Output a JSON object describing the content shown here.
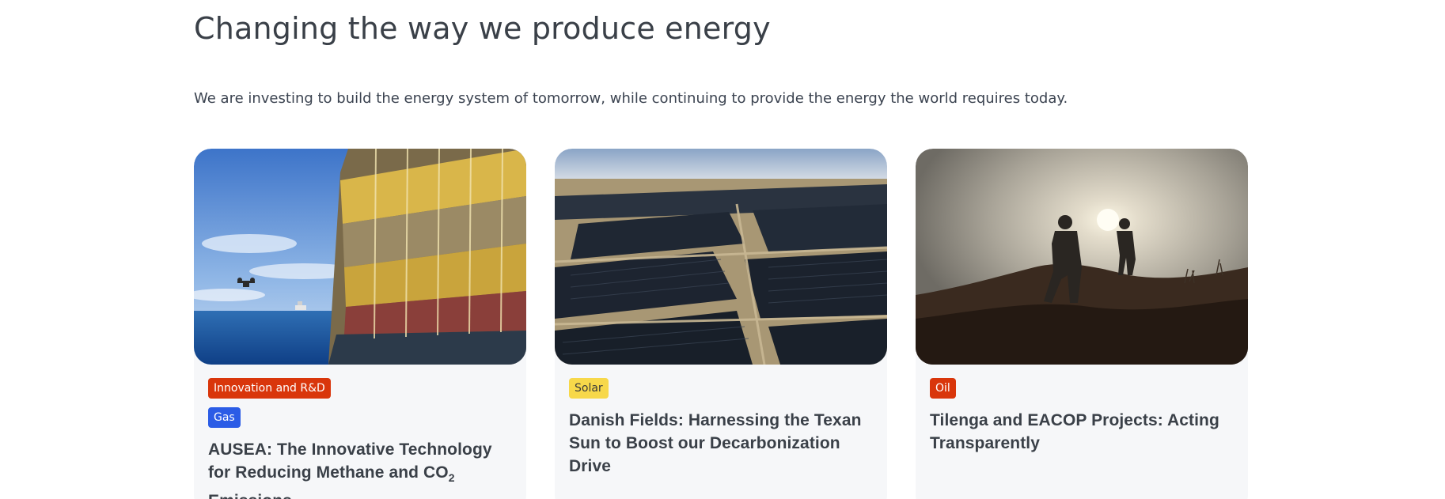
{
  "section": {
    "heading": "Changing the way we produce energy",
    "intro": "We are investing to build the energy system of tomorrow, while continuing to provide the energy the world requires today."
  },
  "cards": [
    {
      "image_icon": "offshore-platform-image",
      "tags": [
        {
          "label": "Innovation and R&D",
          "bg": "#d9360b",
          "fg": "#ffffff"
        },
        {
          "label": "Gas",
          "bg": "#2b5ce6",
          "fg": "#ffffff"
        }
      ],
      "title_pre": "AUSEA: The Innovative Technology for Reducing Methane and CO",
      "title_sub": "2",
      "title_post": " Emissions"
    },
    {
      "image_icon": "solar-farm-image",
      "tags": [
        {
          "label": "Solar",
          "bg": "#f7d84a",
          "fg": "#3a3a3a"
        }
      ],
      "title_pre": "Danish Fields: Harnessing the Texan Sun to Boost our Decarbonization Drive",
      "title_sub": "",
      "title_post": ""
    },
    {
      "image_icon": "hikers-silhouette-image",
      "tags": [
        {
          "label": "Oil",
          "bg": "#d9360b",
          "fg": "#ffffff"
        }
      ],
      "title_pre": "Tilenga and EACOP Projects: Acting Transparently",
      "title_sub": "",
      "title_post": ""
    }
  ]
}
